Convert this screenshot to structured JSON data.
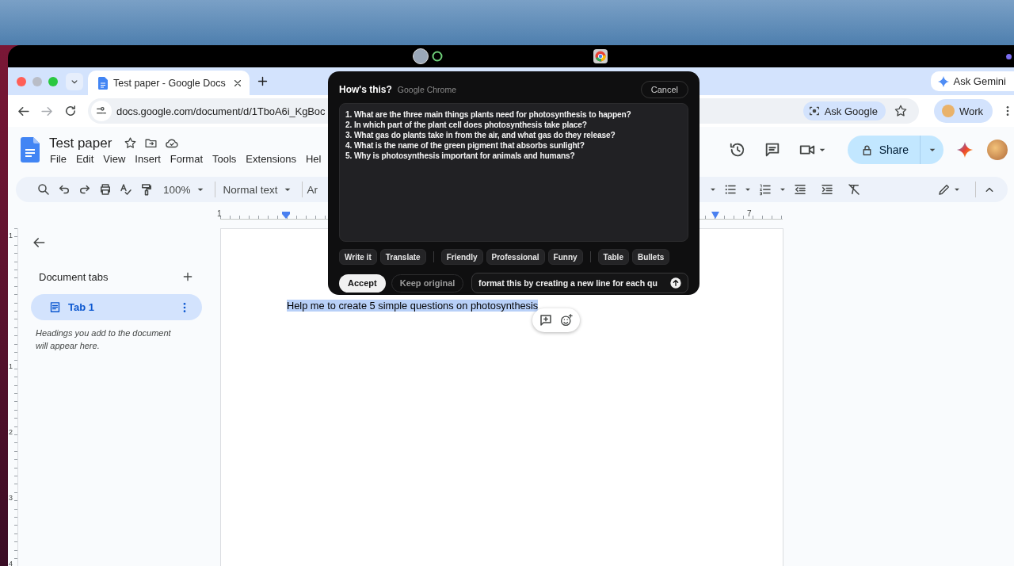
{
  "browser": {
    "tab_title": "Test paper - Google Docs",
    "ask_gemini": "Ask Gemini",
    "url": "docs.google.com/document/d/1TboA6i_KgBoc",
    "ask_google": "Ask Google",
    "profile": "Work"
  },
  "doc": {
    "title": "Test paper",
    "menu": [
      "File",
      "Edit",
      "View",
      "Insert",
      "Format",
      "Tools",
      "Extensions",
      "Hel"
    ],
    "share": "Share"
  },
  "toolbar": {
    "zoom": "100%",
    "style": "Normal text",
    "font": "Ar"
  },
  "ruler": {
    "labels": [
      "1",
      "7"
    ]
  },
  "vertical_ruler": {
    "labels": [
      "1",
      "1",
      "2",
      "3",
      "4"
    ]
  },
  "sidebar": {
    "heading": "Document tabs",
    "tabs": [
      {
        "label": "Tab 1",
        "selected": true
      }
    ],
    "hint": "Headings you add to the document will appear here."
  },
  "page": {
    "text": "Help me to create 5 simple questions on photosynthesis",
    "selected": true
  },
  "popup": {
    "title": "How's this?",
    "source": "Google Chrome",
    "cancel": "Cancel",
    "result": [
      "1. What are the three main things plants need for photosynthesis to happen?",
      "2. In which part of the plant cell does photosynthesis take place?",
      "3. What gas do plants take in from the air, and what gas do they release?",
      "4. What is the name of the green pigment that absorbs sunlight?",
      "5. Why is photosynthesis important for animals and humans?"
    ],
    "chip_groups": [
      [
        "Write it",
        "Translate"
      ],
      [
        "Friendly",
        "Professional",
        "Funny"
      ],
      [
        "Table",
        "Bullets"
      ]
    ],
    "accept": "Accept",
    "keep": "Keep original",
    "prompt": "format this by creating a new line for each qu"
  }
}
